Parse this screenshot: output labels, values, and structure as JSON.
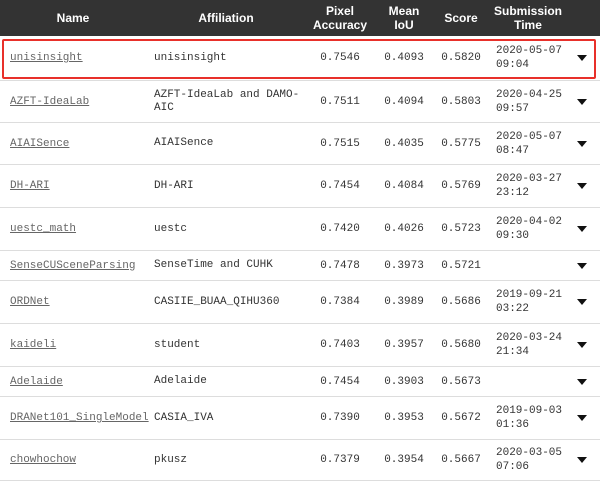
{
  "header": {
    "name": "Name",
    "affiliation": "Affiliation",
    "pixel_accuracy": "Pixel\nAccuracy",
    "mean_iou": "Mean\nIoU",
    "score": "Score",
    "submission_time": "Submission\nTime"
  },
  "rows": [
    {
      "name": "unisinsight",
      "affiliation": "unisinsight",
      "pixel_accuracy": "0.7546",
      "mean_iou": "0.4093",
      "score": "0.5820",
      "time": "2020-05-07\n09:04"
    },
    {
      "name": "AZFT-IdeaLab",
      "affiliation": "AZFT-IdeaLab and DAMO-\nAIC",
      "pixel_accuracy": "0.7511",
      "mean_iou": "0.4094",
      "score": "0.5803",
      "time": "2020-04-25\n09:57"
    },
    {
      "name": "AIAISence",
      "affiliation": "AIAISence",
      "pixel_accuracy": "0.7515",
      "mean_iou": "0.4035",
      "score": "0.5775",
      "time": "2020-05-07\n08:47"
    },
    {
      "name": "DH-ARI",
      "affiliation": "DH-ARI",
      "pixel_accuracy": "0.7454",
      "mean_iou": "0.4084",
      "score": "0.5769",
      "time": "2020-03-27\n23:12"
    },
    {
      "name": "uestc_math",
      "affiliation": "uestc",
      "pixel_accuracy": "0.7420",
      "mean_iou": "0.4026",
      "score": "0.5723",
      "time": "2020-04-02\n09:30"
    },
    {
      "name": "SenseCUSceneParsing",
      "affiliation": "SenseTime and CUHK",
      "pixel_accuracy": "0.7478",
      "mean_iou": "0.3973",
      "score": "0.5721",
      "time": ""
    },
    {
      "name": "ORDNet",
      "affiliation": "CASIIE_BUAA_QIHU360",
      "pixel_accuracy": "0.7384",
      "mean_iou": "0.3989",
      "score": "0.5686",
      "time": "2019-09-21\n03:22"
    },
    {
      "name": "kaideli",
      "affiliation": "student",
      "pixel_accuracy": "0.7403",
      "mean_iou": "0.3957",
      "score": "0.5680",
      "time": "2020-03-24\n21:34"
    },
    {
      "name": "Adelaide",
      "affiliation": "Adelaide",
      "pixel_accuracy": "0.7454",
      "mean_iou": "0.3903",
      "score": "0.5673",
      "time": ""
    },
    {
      "name": "DRANet101_SingleModel",
      "affiliation": "CASIA_IVA",
      "pixel_accuracy": "0.7390",
      "mean_iou": "0.3953",
      "score": "0.5672",
      "time": "2019-09-03\n01:36"
    },
    {
      "name": "chowhochow",
      "affiliation": "pkusz",
      "pixel_accuracy": "0.7379",
      "mean_iou": "0.3954",
      "score": "0.5667",
      "time": "2020-03-05\n07:06"
    }
  ],
  "colors": {
    "header_bg": "#333333",
    "highlight": "#e8302a"
  },
  "icons": {
    "row_expand": "caret-down-icon"
  }
}
